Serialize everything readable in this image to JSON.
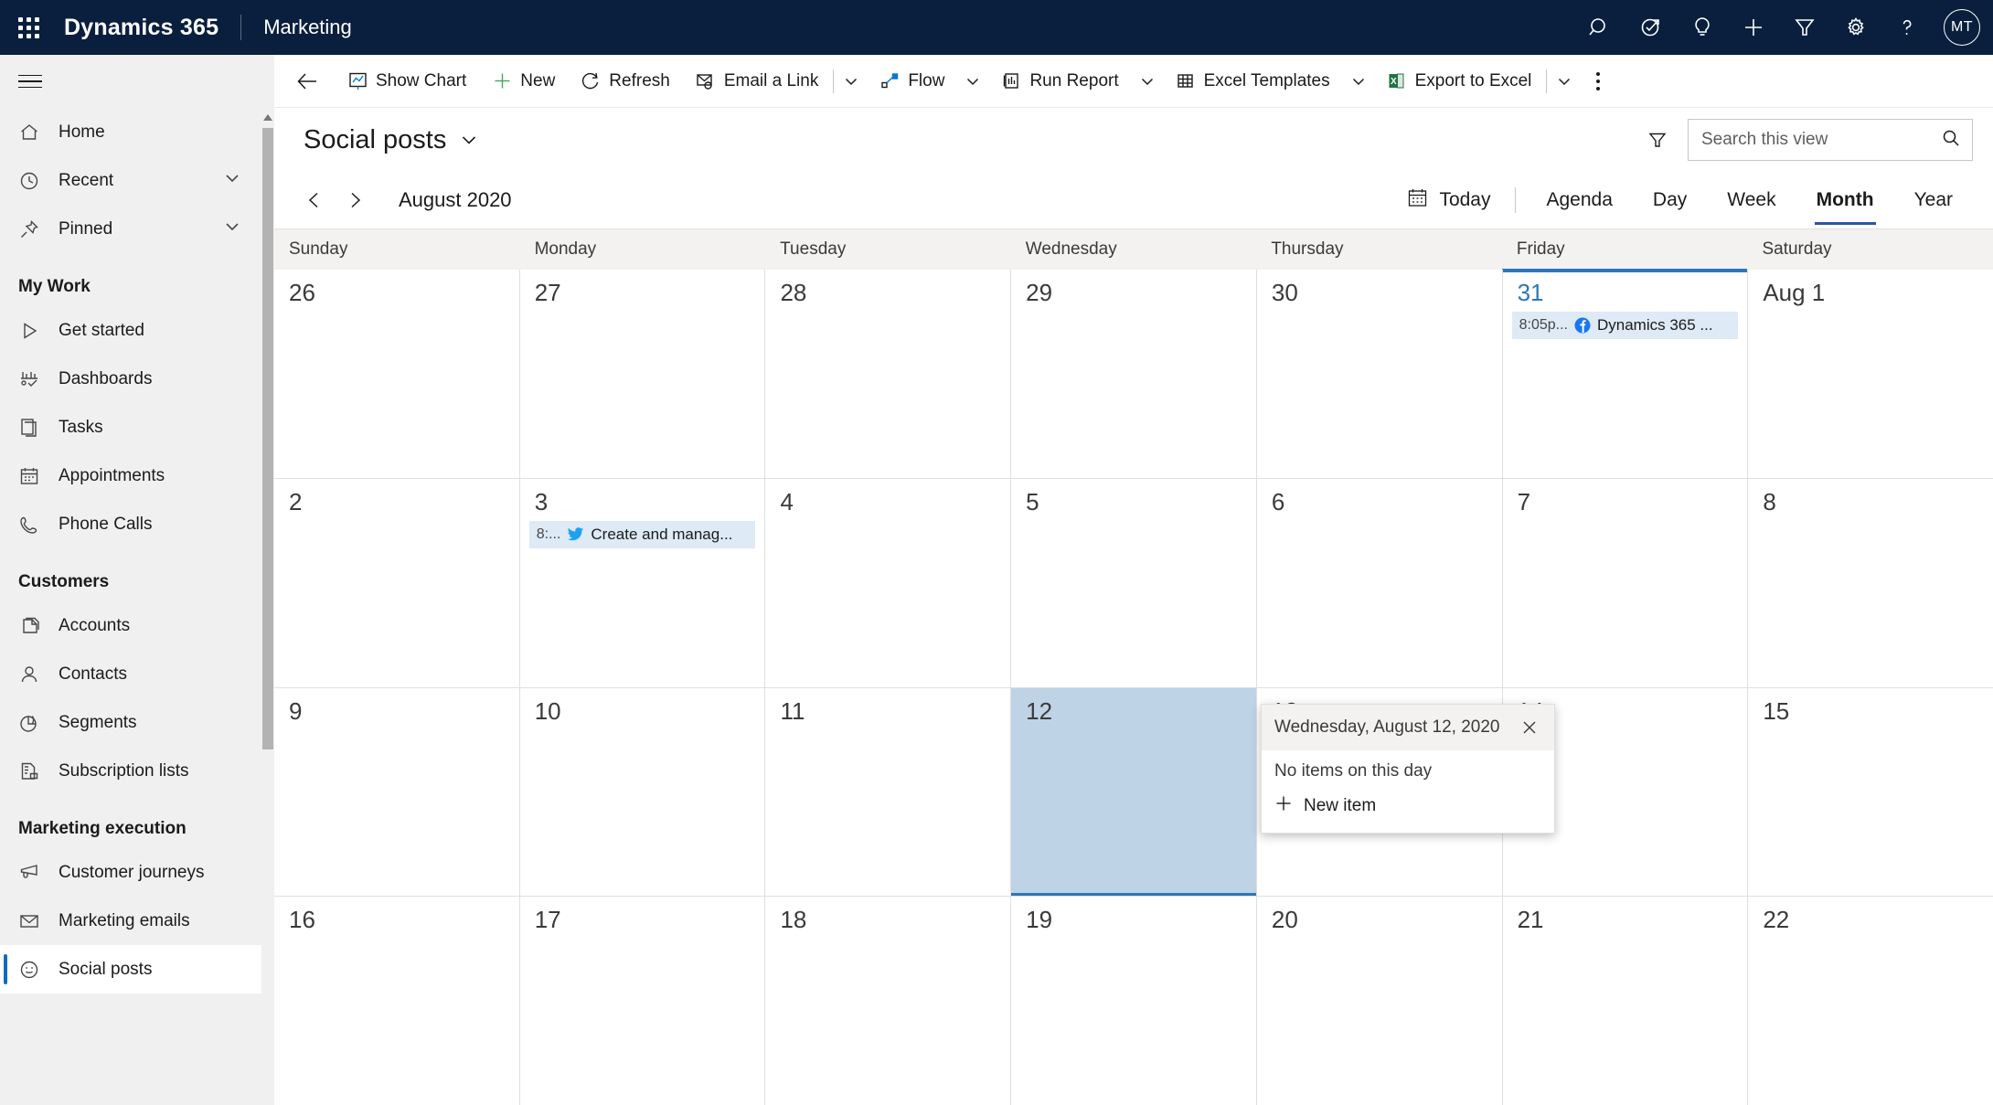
{
  "appbar": {
    "waffle_label": "app-launcher",
    "brand": "Dynamics 365",
    "module": "Marketing",
    "icons": [
      {
        "name": "search-icon",
        "label": "Search"
      },
      {
        "name": "focused-view-icon",
        "label": "Focused view"
      },
      {
        "name": "lightbulb-icon",
        "label": "Assistant"
      },
      {
        "name": "add-icon",
        "label": "Quick create"
      },
      {
        "name": "filter-icon",
        "label": "Filter"
      },
      {
        "name": "gear-icon",
        "label": "Settings"
      },
      {
        "name": "help-icon",
        "label": "Help"
      }
    ],
    "avatar_initials": "MT"
  },
  "sidebar": {
    "top_items": [
      {
        "label": "Home",
        "icon": "home-icon",
        "chevron": false
      },
      {
        "label": "Recent",
        "icon": "clock-icon",
        "chevron": true
      },
      {
        "label": "Pinned",
        "icon": "pin-icon",
        "chevron": true
      }
    ],
    "groups": [
      {
        "title": "My Work",
        "items": [
          {
            "label": "Get started",
            "icon": "play-icon"
          },
          {
            "label": "Dashboards",
            "icon": "dashboard-icon"
          },
          {
            "label": "Tasks",
            "icon": "task-icon"
          },
          {
            "label": "Appointments",
            "icon": "calendar-icon"
          },
          {
            "label": "Phone Calls",
            "icon": "phone-icon"
          }
        ]
      },
      {
        "title": "Customers",
        "items": [
          {
            "label": "Accounts",
            "icon": "account-icon"
          },
          {
            "label": "Contacts",
            "icon": "contact-icon"
          },
          {
            "label": "Segments",
            "icon": "segment-icon"
          },
          {
            "label": "Subscription lists",
            "icon": "subscription-icon"
          }
        ]
      },
      {
        "title": "Marketing execution",
        "items": [
          {
            "label": "Customer journeys",
            "icon": "megaphone-icon"
          },
          {
            "label": "Marketing emails",
            "icon": "envelope-icon"
          },
          {
            "label": "Social posts",
            "icon": "smiley-icon",
            "selected": true
          }
        ]
      }
    ]
  },
  "commandbar": {
    "back_label": "Back",
    "items": [
      {
        "label": "Show Chart",
        "icon": "chart-icon",
        "caret": false
      },
      {
        "label": "New",
        "icon": "plus-icon",
        "caret": false
      },
      {
        "label": "Refresh",
        "icon": "refresh-icon",
        "caret": false
      },
      {
        "label": "Email a Link",
        "icon": "email-link-icon",
        "caret": false
      },
      {
        "label": "Flow",
        "icon": "flow-icon",
        "caret": true
      },
      {
        "label": "Run Report",
        "icon": "report-icon",
        "caret": true
      },
      {
        "label": "Excel Templates",
        "icon": "excel-template-icon",
        "caret": true
      },
      {
        "label": "Export to Excel",
        "icon": "excel-icon",
        "caret": false
      }
    ],
    "overflow_label": "More commands"
  },
  "viewbar": {
    "title": "Social posts",
    "filter_label": "Edit filters",
    "search": {
      "placeholder": "Search this view",
      "value": ""
    }
  },
  "calendar_toolbar": {
    "prev_label": "Previous",
    "next_label": "Next",
    "period": "August 2020",
    "today_label": "Today",
    "modes": [
      {
        "label": "Agenda",
        "active": false
      },
      {
        "label": "Day",
        "active": false
      },
      {
        "label": "Week",
        "active": false
      },
      {
        "label": "Month",
        "active": true
      },
      {
        "label": "Year",
        "active": false
      }
    ]
  },
  "calendar": {
    "day_headers": [
      "Sunday",
      "Monday",
      "Tuesday",
      "Wednesday",
      "Thursday",
      "Friday",
      "Saturday"
    ],
    "today_column_index": 5,
    "weeks": [
      [
        {
          "num": "26"
        },
        {
          "num": "27"
        },
        {
          "num": "28"
        },
        {
          "num": "29"
        },
        {
          "num": "30"
        },
        {
          "num": "31",
          "today": true,
          "events": [
            {
              "time": "8:05p...",
              "icon": "facebook-icon",
              "title": "Dynamics 365 ..."
            }
          ]
        },
        {
          "num": "Aug 1"
        }
      ],
      [
        {
          "num": "2"
        },
        {
          "num": "3",
          "events": [
            {
              "time": "8:...",
              "icon": "twitter-icon",
              "title": "Create and manag..."
            }
          ]
        },
        {
          "num": "4"
        },
        {
          "num": "5"
        },
        {
          "num": "6"
        },
        {
          "num": "7"
        },
        {
          "num": "8"
        }
      ],
      [
        {
          "num": "9"
        },
        {
          "num": "10"
        },
        {
          "num": "11"
        },
        {
          "num": "12",
          "selected": true
        },
        {
          "num": "13"
        },
        {
          "num": "14"
        },
        {
          "num": "15"
        }
      ],
      [
        {
          "num": "16"
        },
        {
          "num": "17"
        },
        {
          "num": "18"
        },
        {
          "num": "19"
        },
        {
          "num": "20"
        },
        {
          "num": "21"
        },
        {
          "num": "22"
        }
      ]
    ]
  },
  "callout": {
    "title": "Wednesday, August 12, 2020",
    "close_label": "Close",
    "empty_text": "No items on this day",
    "new_item_label": "New item"
  },
  "colors": {
    "appbar_bg": "#091F3D",
    "accent": "#2b78b8",
    "selected_day_bg": "#bed3e5",
    "event_bg": "#deeaf6",
    "facebook_blue": "#1877F2",
    "twitter_blue": "#1DA1F2",
    "excel_green": "#217346"
  }
}
